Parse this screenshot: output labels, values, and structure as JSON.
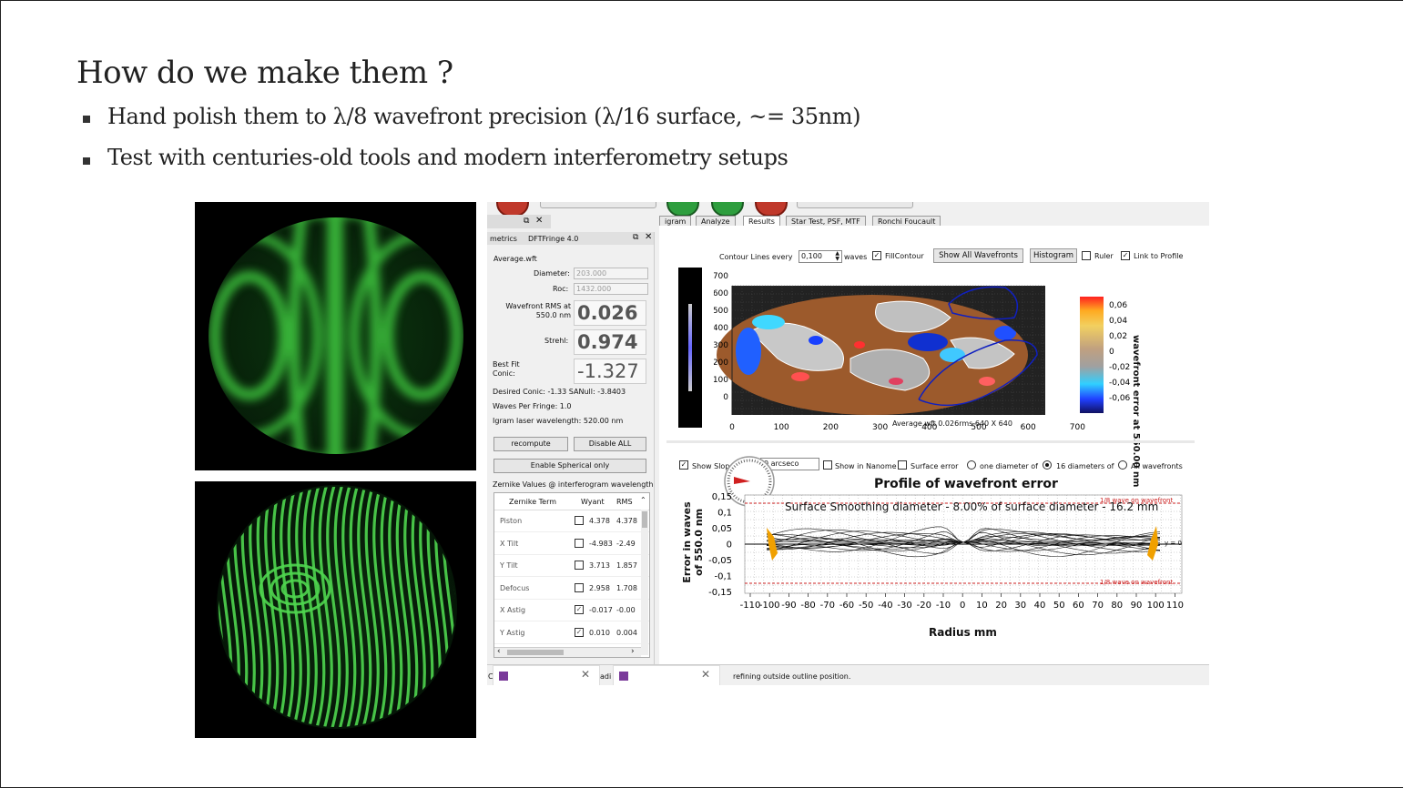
{
  "slide": {
    "title": "How do we make them ?",
    "bullets": [
      "Hand polish them to λ/8 wavefront precision (λ/16 surface, ~= 35nm)",
      "Test with centuries-old tools and modern interferometry setups"
    ]
  },
  "app": {
    "tabs": [
      "igram",
      "Analyze",
      "Results",
      "Star Test, PSF, MTF",
      "Ronchi  Foucault"
    ],
    "panel_header_left": "metrics",
    "panel_header_title": "DFTFringe 4.0",
    "file_name": "Average.wft",
    "diameter_label": "Diameter:",
    "diameter_value": "203.000",
    "roc_label": "Roc:",
    "roc_value": "1432.000",
    "rms_label": "Wavefront RMS at 550.0 nm",
    "rms_value": "0.026",
    "strehl_label": "Strehl:",
    "strehl_value": "0.974",
    "bestfit_label": "Best Fit Conic:",
    "bestfit_value": "-1.327",
    "desired_conic": "Desired Conic:  -1.33 SANull: -3.8403",
    "waves_per_fringe": "Waves Per Fringe: 1.0",
    "laser_wavelength": "Igram laser wavelength: 520.00 nm",
    "recompute_label": "recompute",
    "disable_all_label": "Disable ALL",
    "enable_spherical_label": "Enable Spherical only",
    "zernike_caption": "Zernike Values @ interferogram wavelength",
    "zernike_headers": [
      "Zernike Term",
      "Wyant",
      "RMS"
    ],
    "zernike_rows": [
      {
        "term": "Piston",
        "checked": false,
        "wyant": "4.378",
        "rms": "4.378"
      },
      {
        "term": "X Tilt",
        "checked": false,
        "wyant": "-4.983",
        "rms": "-2.49"
      },
      {
        "term": "Y Tilt",
        "checked": false,
        "wyant": "3.713",
        "rms": "1.857"
      },
      {
        "term": "Defocus",
        "checked": false,
        "wyant": "2.958",
        "rms": "1.708"
      },
      {
        "term": "X Astig",
        "checked": true,
        "wyant": "-0.017",
        "rms": "-0.00"
      },
      {
        "term": "Y Astig",
        "checked": true,
        "wyant": "0.010",
        "rms": "0.004"
      }
    ],
    "contour_label": "Contour Lines every",
    "contour_value": "0,100",
    "waves_label": "waves",
    "fillcontour_label": "FillContour",
    "show_all_label": "Show All Wavefronts",
    "histogram_label": "Histogram",
    "ruler_label": "Ruler",
    "link_profile_label": "Link to Profile",
    "contour_y_ticks": [
      "700",
      "600",
      "500",
      "400",
      "300",
      "200",
      "100",
      "0"
    ],
    "contour_x_ticks": [
      "0",
      "100",
      "200",
      "300",
      "400",
      "500",
      "600",
      "700"
    ],
    "contour_caption": "Average.wft  0.026rms 640 X 640",
    "colorbar_ticks": [
      "0,06",
      "0,04",
      "0,02",
      "0",
      "-0,02",
      "-0,04",
      "-0,06"
    ],
    "colorbar_title": "wavefront error at 550.00 nm",
    "show_slope_label": "Show Slop",
    "arcsec_value": "0 arcseco",
    "show_nanome_label": "Show in Nanome",
    "surface_error_label": "Surface error",
    "one_diameter_label": "one diameter of",
    "sixteen_diameters_label": "16 diameters of",
    "all_wavefronts_label": "All wavefronts",
    "profile_title": "Profile of wavefront error",
    "smoothing_label": "Surface Smoothing diameter - 8.00% of surface diameter - 16.2 mm",
    "top_ref_label": "1/8 wave on wavefront",
    "bottom_ref_label": "1/8 wave on wavefront",
    "y0_label": "y = 0",
    "profile_ylabel_1": "Error in waves",
    "profile_ylabel_2": "of  550.0 nm",
    "profile_y_ticks": [
      "0,15",
      "0,1",
      "0,05",
      "0",
      "-0,05",
      "-0,1",
      "-0,15"
    ],
    "profile_x_ticks": [
      "-110",
      "-100",
      "-90",
      "-80",
      "-70",
      "-60",
      "-50",
      "-40",
      "-30",
      "-20",
      "-10",
      "0",
      "10",
      "20",
      "30",
      "40",
      "50",
      "60",
      "70",
      "80",
      "90",
      "100",
      "110"
    ],
    "profile_xlabel": "Radius mm",
    "status_text": "refining outside outline position.",
    "status_frag_1": "C",
    "status_frag_2": "adi"
  },
  "colors": {
    "fringe_green": "#3fc83f",
    "profile_red": "#cc2222",
    "orange_mark": "#f0a000"
  }
}
